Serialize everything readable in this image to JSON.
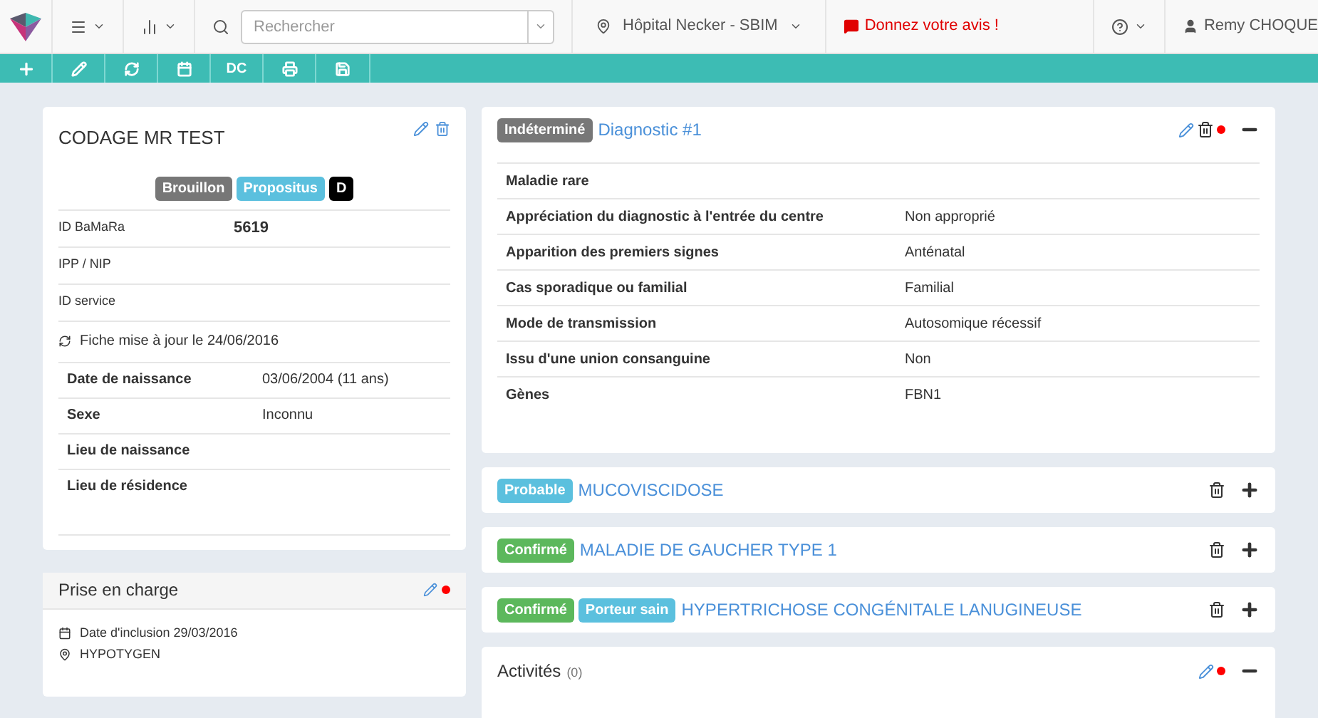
{
  "navbar": {
    "search": {
      "placeholder": "Rechercher"
    },
    "location": "Hôpital Necker - SBIM",
    "feedback": "Donnez votre avis !",
    "user": "Remy CHOQUE"
  },
  "toolbar": [
    {
      "kind": "plus"
    },
    {
      "kind": "pencil"
    },
    {
      "kind": "refresh"
    },
    {
      "kind": "calendar"
    },
    {
      "kind": "text",
      "label": "DC"
    },
    {
      "kind": "print"
    },
    {
      "kind": "save"
    }
  ],
  "patient_card": {
    "title": "CODAGE MR TEST",
    "badges": [
      {
        "label": "Brouillon",
        "color": "#777777"
      },
      {
        "label": "Propositus",
        "color": "#5bc0de"
      },
      {
        "label": "D",
        "color": "#000000"
      }
    ],
    "ids": [
      {
        "label": "ID BaMaRa",
        "value": "5619"
      },
      {
        "label": "IPP / NIP"
      },
      {
        "label": "ID service"
      }
    ],
    "updated": "Fiche mise à jour le 24/06/2016",
    "details": [
      {
        "label": "Date de naissance",
        "value": "03/06/2004 (11 ans)"
      },
      {
        "label": "Sexe",
        "value": "Inconnu"
      },
      {
        "label": "Lieu de naissance"
      },
      {
        "label": "Lieu de résidence"
      }
    ]
  },
  "care_card": {
    "title": "Prise en charge",
    "alert": true,
    "inclusion": "Date d'inclusion 29/03/2016",
    "place": "HYPOTYGEN"
  },
  "diagnoses": [
    {
      "badges": [
        {
          "label": "Indéterminé",
          "color": "#777777"
        }
      ],
      "title": "Diagnostic #1",
      "editable": true,
      "alert": true,
      "expanded": true,
      "rows": [
        {
          "label": "Maladie rare"
        },
        {
          "label": "Appréciation du diagnostic à l'entrée du centre",
          "value": "Non approprié"
        },
        {
          "label": "Apparition des premiers signes",
          "value": "Anténatal"
        },
        {
          "label": "Cas sporadique ou familial",
          "value": "Familial"
        },
        {
          "label": "Mode de transmission",
          "value": "Autosomique récessif"
        },
        {
          "label": "Issu d'une union consanguine",
          "value": "Non"
        },
        {
          "label": "Gènes",
          "value": "FBN1"
        }
      ]
    },
    {
      "badges": [
        {
          "label": "Probable",
          "color": "#5bc0de"
        }
      ],
      "title": "MUCOVISCIDOSE",
      "editable": false,
      "alert": false,
      "expanded": false
    },
    {
      "badges": [
        {
          "label": "Confirmé",
          "color": "#5cb85c"
        }
      ],
      "title": "MALADIE DE GAUCHER TYPE 1",
      "editable": false,
      "alert": false,
      "expanded": false
    },
    {
      "badges": [
        {
          "label": "Confirmé",
          "color": "#5cb85c"
        },
        {
          "label": "Porteur sain",
          "color": "#5bc0de"
        }
      ],
      "title": "HYPERTRICHOSE CONGÉNITALE LANUGINEUSE",
      "editable": false,
      "alert": false,
      "expanded": false
    }
  ],
  "activities": {
    "title": "Activités",
    "count": "(0)",
    "alert": true,
    "expanded": true
  }
}
